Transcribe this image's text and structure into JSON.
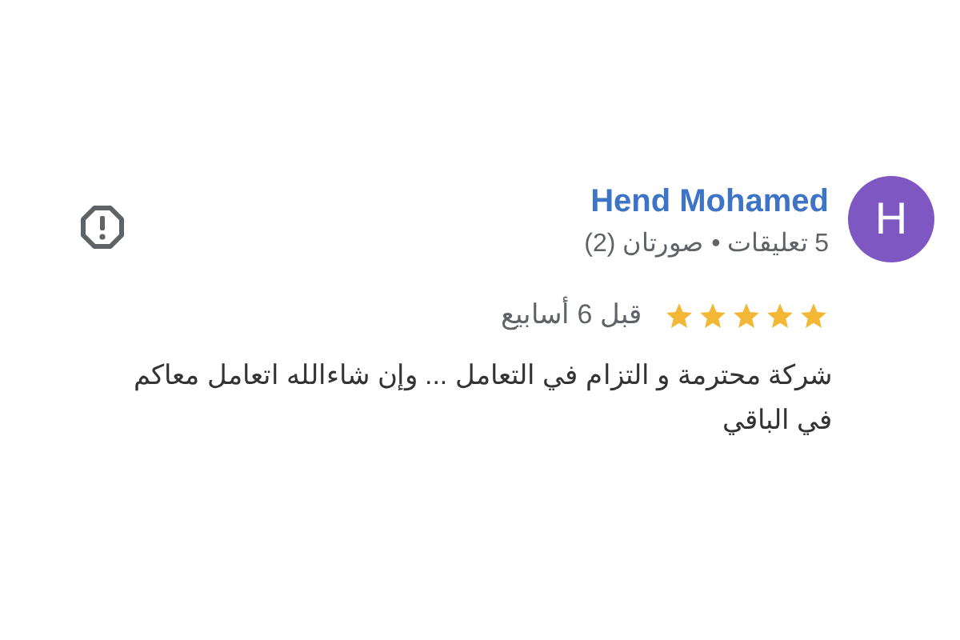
{
  "review": {
    "author": "Hend Mohamed",
    "avatar_letter": "H",
    "author_meta": "5 تعليقات • صورتان (2)",
    "stars": 5,
    "time": "قبل 6 أسابيع",
    "text": "شركة محترمة و التزام في التعامل ... وإن شاءالله اتعامل معاكم في الباقي"
  }
}
